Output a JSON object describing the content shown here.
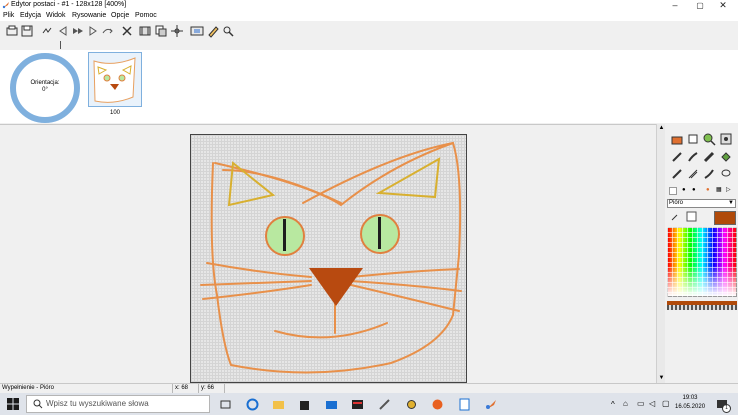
{
  "window": {
    "title": "Edytor postaci - #1 - 128x128 [400%]",
    "min": "–",
    "max": "▢",
    "close": "✕"
  },
  "menu": [
    "Plik",
    "Edycja",
    "Widok",
    "Rysowanie",
    "Opcje",
    "Pomoc"
  ],
  "toolbar_icons": [
    "open-icon",
    "save-icon",
    "undo-icon",
    "prev-frame-icon",
    "fast-forward-icon",
    "next-frame-icon",
    "redo-icon",
    "delete-icon",
    "film-icon",
    "copy-frame-icon",
    "move-icon",
    "preview-icon",
    "edit-icon",
    "settings-icon"
  ],
  "orientation": {
    "line1": "Orientacja:",
    "line2": "0°"
  },
  "frame": {
    "label": "100"
  },
  "tools": [
    "fill-icon",
    "eraser-icon",
    "zoom-icon",
    "color-picker-icon",
    "pen-icon",
    "brush-icon",
    "brush2-icon",
    "paint-can-icon",
    "brush3-icon",
    "brush4-icon",
    "brush5-icon",
    "lasso-icon"
  ],
  "pen": {
    "selected": "Pióro",
    "dropdown": "▼"
  },
  "colors": {
    "current": "#b04a0a",
    "accent": "#7fb0de"
  },
  "status": {
    "mode": "Wypełnienie - Pióro",
    "x": "x: 68",
    "y": "y: 66"
  },
  "taskbar": {
    "search_placeholder": "Wpisz tu wyszukiwane słowa",
    "time": "19:03",
    "date": "16.05.2020",
    "notification_count": "1"
  }
}
